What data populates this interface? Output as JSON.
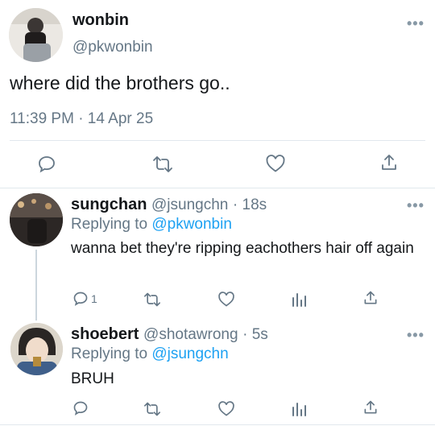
{
  "tweet": {
    "name": "wonbin",
    "handle": "@pkwonbin",
    "text": "where did the brothers go..",
    "timestamp": "11:39 PM · 14 Apr 25",
    "actions": [
      "reply-icon",
      "retweet-icon",
      "like-icon",
      "share-icon"
    ]
  },
  "replies": [
    {
      "name": "sungchan",
      "handle": "@jsungchn",
      "time": "· 18s",
      "replying_prefix": "Replying to ",
      "replying_to": "@pkwonbin",
      "text": "wanna bet they're ripping eachothers hair off again",
      "reply_count": "1"
    },
    {
      "name": "shoebert",
      "handle": "@shotawrong",
      "time": "· 5s",
      "replying_prefix": "Replying to ",
      "replying_to": "@jsungchn",
      "text": "BRUH",
      "reply_count": ""
    }
  ],
  "more_label": "•••",
  "colors": {
    "accent": "#1da1f2",
    "secondary_text": "#657786",
    "divider": "#e1e8ed"
  }
}
